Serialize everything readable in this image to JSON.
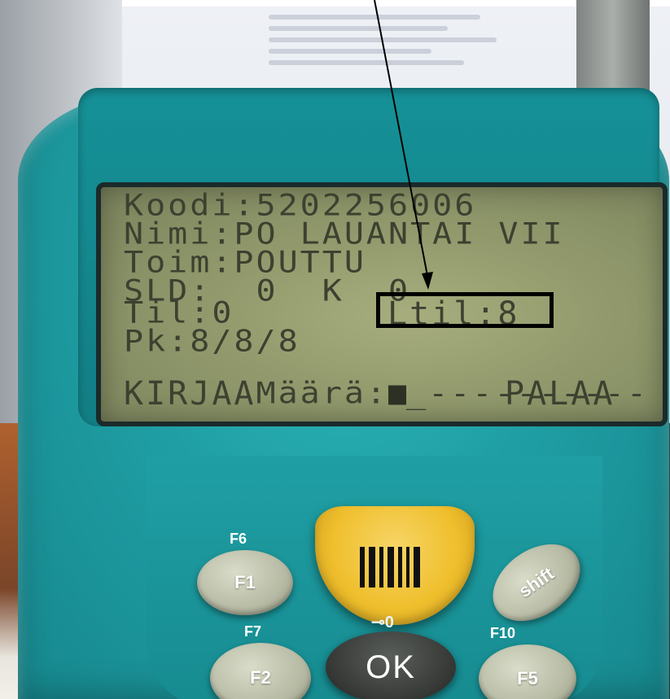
{
  "screen": {
    "rows": [
      "Koodi:5202256006",
      "Nimi:PO LAUANTAI VII",
      "Toim:POUTTU",
      "SLD:  0  K  0",
      "Til:0",
      "Pk:8/8/8",
      "Määrä:"
    ],
    "ltil": "Ltil:8",
    "quantity_dashes": "_----------",
    "left_softkey": "KIRJAA",
    "right_softkey": "PALAA"
  },
  "keypad": {
    "f6": "F6",
    "f1": "F1",
    "f7": "F7",
    "f2": "F2",
    "f10": "F10",
    "f5": "F5",
    "shift": "shift",
    "ok": "OK",
    "key_symbol": "⊸0"
  },
  "colors": {
    "device_body": "#1f9fa4",
    "lcd_background": "#929a6d",
    "lcd_text": "#3c4130",
    "scan_key": "#efbf2d",
    "highlight_border": "#000000"
  },
  "icons": {
    "scan_key_icon": "barcode-icon",
    "key_icon": "key-icon"
  }
}
